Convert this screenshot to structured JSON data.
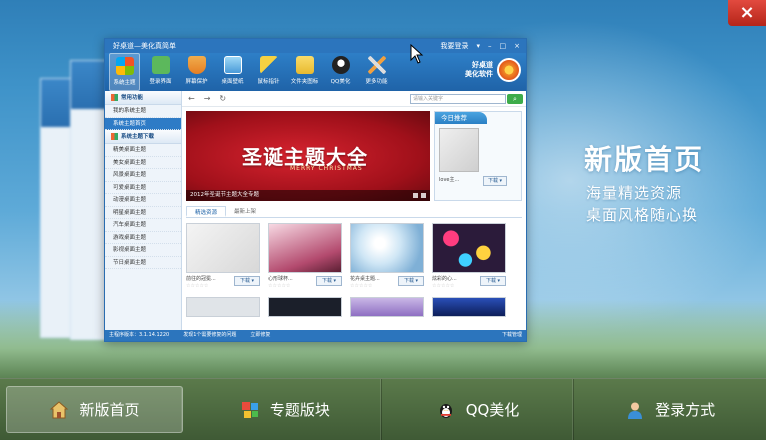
{
  "window": {
    "close_label": "×"
  },
  "app": {
    "title": "好桌道—美化真简单",
    "titlebar_right": {
      "login": "我要登录",
      "menu": "▾",
      "min": "–",
      "max": "□",
      "close": "×"
    },
    "toolbar": [
      {
        "label": "系统主题",
        "color": "#4f9de0",
        "icon": "windows-icon",
        "active": true
      },
      {
        "label": "登录界面",
        "color": "#5cb85c",
        "icon": "login-screen-icon"
      },
      {
        "label": "屏幕保护",
        "color": "#f0ad4e",
        "icon": "shield-icon"
      },
      {
        "label": "桌面壁纸",
        "color": "#7fc7f0",
        "icon": "wallpaper-icon"
      },
      {
        "label": "鼠标指针",
        "color": "#f5d142",
        "icon": "cursor-icon"
      },
      {
        "label": "文件夹图标",
        "color": "#f4c542",
        "icon": "folder-icon"
      },
      {
        "label": "QQ美化",
        "color": "#222222",
        "icon": "qq-icon"
      },
      {
        "label": "更多功能",
        "color": "#c0c0c0",
        "icon": "tools-icon"
      }
    ],
    "brand": {
      "line1": "好桌道",
      "line2": "美化软件"
    },
    "sidebar": {
      "section1": "常用功能",
      "items1": [
        "我的系统主题",
        "系统主题首页"
      ],
      "section2": "系统主题下载",
      "items2": [
        "精美桌面主题",
        "美女桌面主题",
        "风景桌面主题",
        "可爱桌面主题",
        "动漫桌面主题",
        "明星桌面主题",
        "汽车桌面主题",
        "游戏桌面主题",
        "影视桌面主题",
        "节日桌面主题"
      ]
    },
    "search_placeholder": "请输入关键字",
    "banner": {
      "title": "圣诞主题大全",
      "subtitle": "MERRY CHRISTMAS",
      "caption": "2012年圣诞节主题大全专题"
    },
    "recommend": {
      "header": "今日推荐",
      "title": "love主...",
      "download": "下载 ▾"
    },
    "tabs": [
      "精选资源",
      "最新上架"
    ],
    "cards": [
      {
        "name": "前往的冠冕...",
        "download": "下载 ▾"
      },
      {
        "name": "心形球杯...",
        "download": "下载 ▾"
      },
      {
        "name": "花卉桌主题...",
        "download": "下载 ▾"
      },
      {
        "name": "炫彩的心...",
        "download": "下载 ▾"
      }
    ],
    "stars": "☆☆☆☆☆",
    "status": {
      "version": "主程序版本：3.1.14.1220",
      "notice": "发现1个需要修复的问题",
      "fix": "立即修复",
      "manager": "下载管理"
    }
  },
  "promo": {
    "title": "新版首页",
    "line1": "海量精选资源",
    "line2": "桌面风格随心换"
  },
  "bottom_nav": [
    {
      "label": "新版首页",
      "icon": "home-icon",
      "active": true
    },
    {
      "label": "专题版块",
      "icon": "topic-blocks-icon"
    },
    {
      "label": "QQ美化",
      "icon": "qq-penguin-icon"
    },
    {
      "label": "登录方式",
      "icon": "user-icon"
    }
  ]
}
